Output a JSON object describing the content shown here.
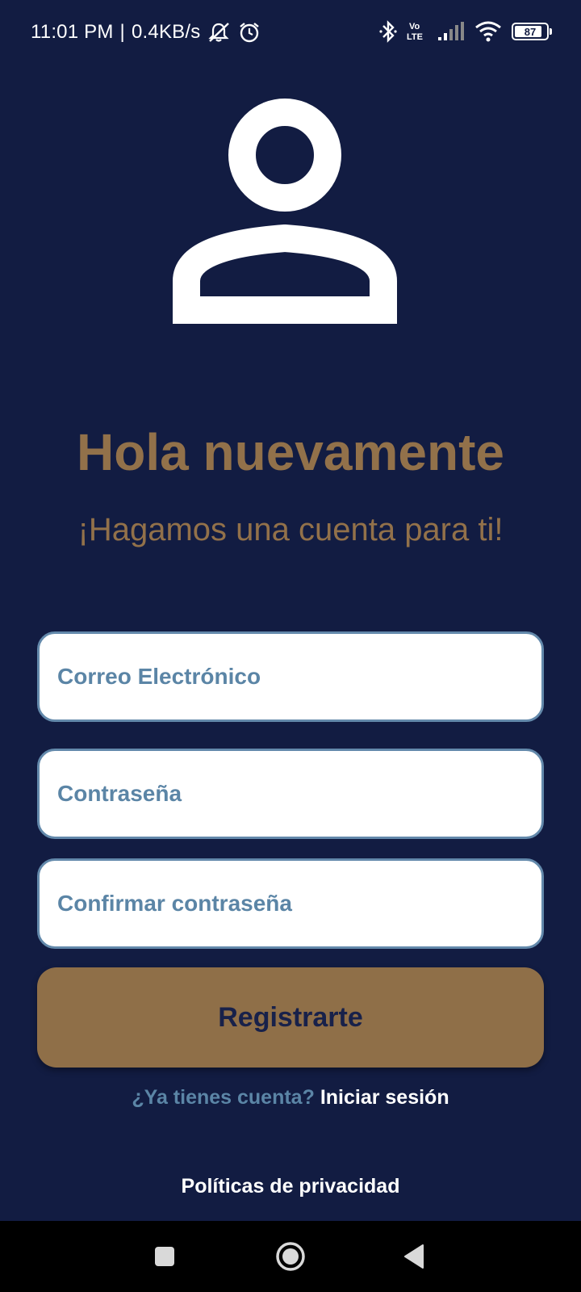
{
  "status_bar": {
    "time": "11:01 PM",
    "separator": "|",
    "net_speed": "0.4KB/s",
    "battery": "87",
    "icons": [
      "notifications-off-icon",
      "alarm-icon",
      "bluetooth-icon",
      "volte-icon",
      "signal-icon",
      "wifi-icon",
      "battery-icon"
    ]
  },
  "header": {
    "avatar_icon": "user-icon",
    "title": "Hola nuevamente",
    "subtitle": "¡Hagamos una cuenta para ti!"
  },
  "form": {
    "email_placeholder": "Correo Electrónico",
    "email_value": "",
    "password_placeholder": "Contraseña",
    "password_value": "",
    "confirm_placeholder": "Confirmar contraseña",
    "confirm_value": "",
    "submit_label": "Registrarte"
  },
  "login": {
    "question": "¿Ya tienes cuenta?",
    "link": "Iniciar sesión"
  },
  "footer": {
    "privacy_link": "Políticas de privacidad"
  },
  "nav": {
    "icons": [
      "recents-icon",
      "home-icon",
      "back-icon"
    ]
  },
  "colors": {
    "background": "#121c42",
    "accent": "#92714a",
    "field_border": "#6389ab",
    "field_text": "#5b85a6",
    "button": "#8f6f48"
  }
}
